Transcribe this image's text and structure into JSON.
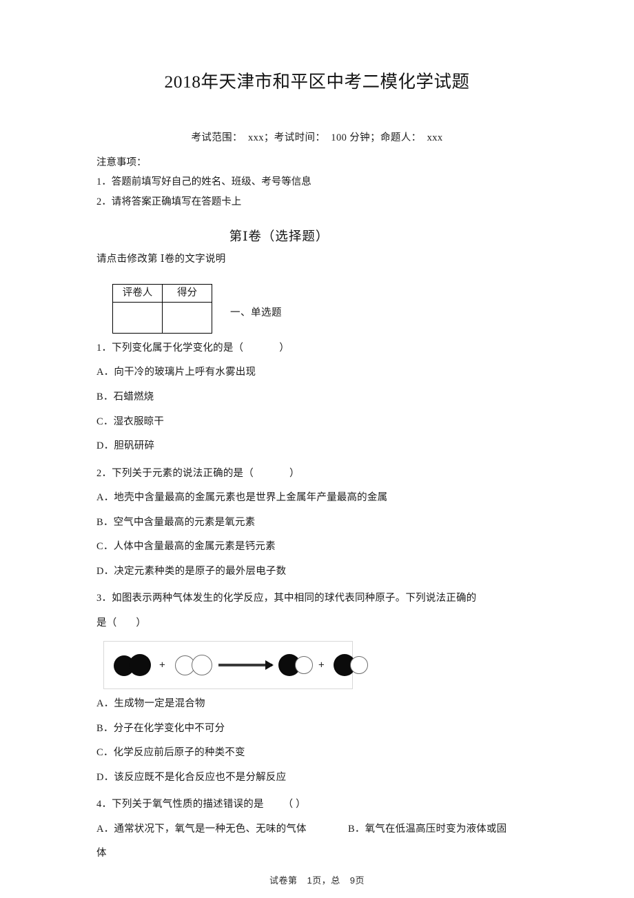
{
  "document": {
    "title": "2018年天津市和平区中考二模化学试题",
    "exam_meta": {
      "scope_label": "考试范围：",
      "scope_value": "xxx；",
      "duration_label": "考试时间：",
      "duration_value": "100 分钟；",
      "author_label": "命题人：",
      "author_value": "xxx"
    },
    "notice": {
      "heading": "注意事项：",
      "items": [
        "1．答题前填写好自己的姓名、班级、考号等信息",
        "2．请将答案正确填写在答题卡上"
      ]
    },
    "section": {
      "heading": "第Ⅰ卷（选择题）",
      "subtext": "请点击修改第 Ⅰ卷的文字说明"
    },
    "score_table": {
      "headers": [
        "评卷人",
        "得分"
      ],
      "body_row": [
        "",
        ""
      ]
    },
    "group_label": "一、单选题",
    "questions": [
      {
        "number": "1．",
        "stem": "下列变化属于化学变化的是（",
        "stem_close": "）",
        "options": [
          "A．向干冷的玻璃片上呼有水雾出现",
          "B．石蜡燃烧",
          "C．湿衣服晾干",
          "D．胆矾研碎"
        ]
      },
      {
        "number": "2．",
        "stem": "下列关于元素的说法正确的是（",
        "stem_close": "）",
        "options": [
          "A．地壳中含量最高的金属元素也是世界上金属年产量最高的金属",
          "B．空气中含量最高的元素是氧元素",
          "C．人体中含量最高的金属元素是钙元素",
          "D．决定元素种类的是原子的最外层电子数"
        ]
      },
      {
        "number": "3．",
        "stem_line1": "如图表示两种气体发生的化学反应，其中相同的球代表同种原子。下列说法正确的",
        "stem_line2": "是（",
        "stem_close": "）",
        "figure": {
          "name": "chemical-reaction-diagram",
          "description": "两个黑球分子 + 两个白球分子 → 两个黑白双原子分子",
          "plus_symbol": "+",
          "reactant_1": "black-black",
          "reactant_2": "white-white",
          "product_1": "black-white",
          "product_2": "black-white"
        },
        "options": [
          "A．生成物一定是混合物",
          "B．分子在化学变化中不可分",
          "C．化学反应前后原子的种类不变",
          "D．该反应既不是化合反应也不是分解反应"
        ]
      },
      {
        "number": "4．",
        "stem": "下列关于氧气性质的描述错误的是",
        "stem_close": "（ ）",
        "option_a": "A．通常状况下，氧气是一种无色、无味的气体",
        "option_b": "B．氧气在低温高压时变为液体或固",
        "option_b_wrap": "体"
      }
    ],
    "footer": {
      "prefix": "试卷第",
      "page": "1",
      "mid": "页，总",
      "total": "9",
      "suffix": "页"
    }
  }
}
